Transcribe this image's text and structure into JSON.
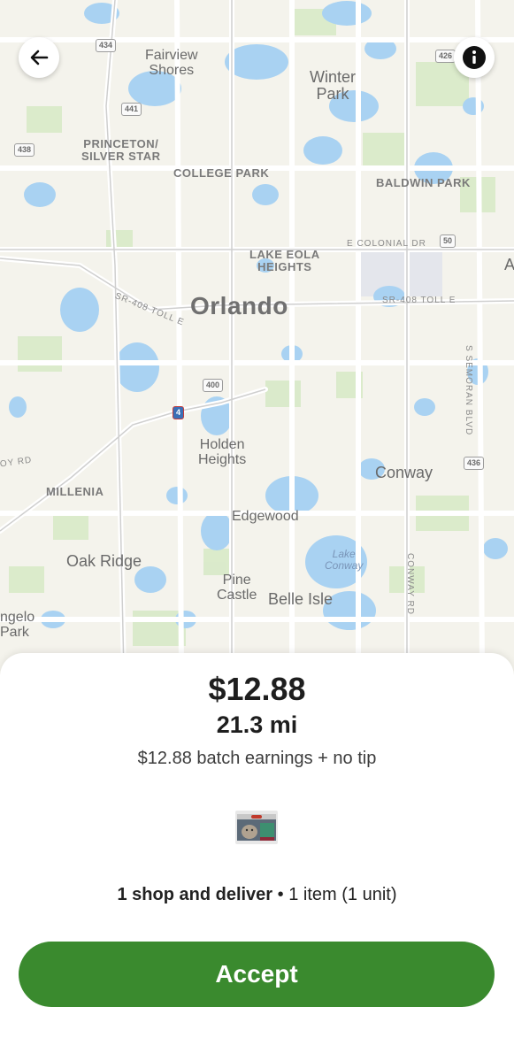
{
  "map": {
    "places": [
      {
        "id": "fairview-shores",
        "text": "Fairview\nShores"
      },
      {
        "id": "winter-park",
        "text": "Winter\nPark"
      },
      {
        "id": "princeton-silver-star",
        "text": "PRINCETON/\nSILVER STAR"
      },
      {
        "id": "college-park",
        "text": "COLLEGE PARK"
      },
      {
        "id": "baldwin-park",
        "text": "BALDWIN PARK"
      },
      {
        "id": "lake-eola-heights",
        "text": "LAKE EOLA\nHEIGHTS"
      },
      {
        "id": "orlando",
        "text": "Orlando"
      },
      {
        "id": "holden-heights",
        "text": "Holden\nHeights"
      },
      {
        "id": "conway",
        "text": "Conway"
      },
      {
        "id": "millenia",
        "text": "MILLENIA"
      },
      {
        "id": "edgewood",
        "text": "Edgewood"
      },
      {
        "id": "oak-ridge",
        "text": "Oak Ridge"
      },
      {
        "id": "lake-conway",
        "text": "Lake\nConway"
      },
      {
        "id": "pine-castle",
        "text": "Pine\nCastle"
      },
      {
        "id": "belle-isle",
        "text": "Belle Isle"
      },
      {
        "id": "angelo-park",
        "text": "ngelo\nPark"
      },
      {
        "id": "edge-a",
        "text": "A"
      }
    ],
    "roads": [
      {
        "id": "sr408-west",
        "text": "SR-408 TOLL E"
      },
      {
        "id": "sr408-east",
        "text": "SR-408 TOLL E"
      },
      {
        "id": "e-colonial",
        "text": "E COLONIAL DR"
      },
      {
        "id": "semoran",
        "text": "S SEMORAN BLVD"
      },
      {
        "id": "conway-rd",
        "text": "CONWAY RD"
      },
      {
        "id": "oy-rd",
        "text": "OY RD"
      }
    ],
    "shields": [
      {
        "id": "s434",
        "text": "434"
      },
      {
        "id": "s441",
        "text": "441"
      },
      {
        "id": "s438",
        "text": "438"
      },
      {
        "id": "s426",
        "text": "426"
      },
      {
        "id": "s50",
        "text": "50"
      },
      {
        "id": "s400",
        "text": "400"
      },
      {
        "id": "s4",
        "text": "4"
      },
      {
        "id": "s436",
        "text": "436"
      }
    ]
  },
  "header": {
    "back_icon": "arrow-left-icon",
    "info_icon": "info-icon"
  },
  "offer": {
    "price": "$12.88",
    "distance": "21.3 mi",
    "earnings": "$12.88 batch earnings + no tip",
    "item_image": "cat-food-product-image",
    "summary_type": "1 shop and deliver",
    "summary_separator": "•",
    "summary_items": "1 item (1 unit)",
    "accept_label": "Accept"
  },
  "colors": {
    "accent": "#3a8a2e",
    "water": "#a9d2f2",
    "park": "#d3e8c4",
    "map_bg": "#f4f3ec"
  }
}
